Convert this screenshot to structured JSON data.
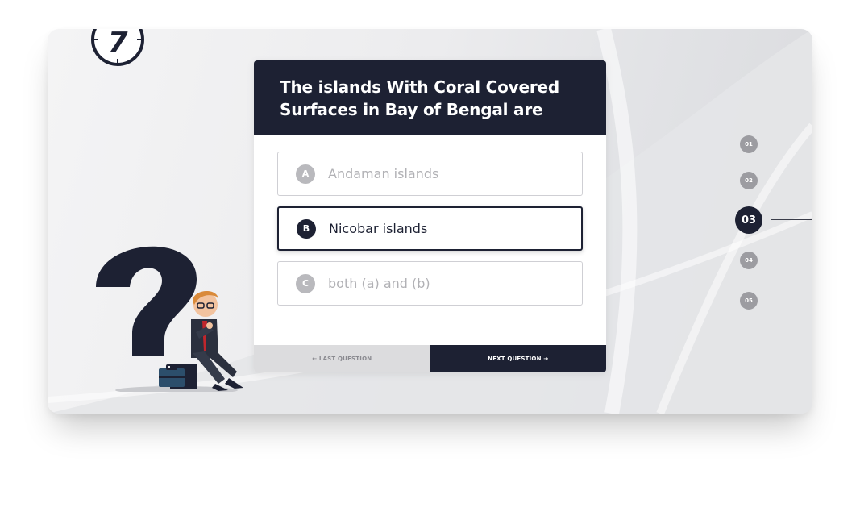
{
  "timer": {
    "value": "7"
  },
  "question": {
    "line1": "The islands With Coral Covered",
    "line2": "Surfaces in Bay of Bengal are"
  },
  "options": [
    {
      "letter": "A",
      "text": "Andaman islands",
      "selected": false
    },
    {
      "letter": "B",
      "text": "Nicobar islands",
      "selected": true
    },
    {
      "letter": "C",
      "text": "both (a) and (b)",
      "selected": false
    }
  ],
  "nav": {
    "prev_label": "← LAST QUESTION",
    "next_label": "NEXT QUESTION →"
  },
  "steps": [
    "01",
    "02",
    "03",
    "04",
    "05"
  ],
  "active_step": "03",
  "colors": {
    "primary": "#1d2133",
    "muted": "#9c9ca1",
    "border": "#cfcfd4"
  },
  "icons": {
    "timer": "stopwatch-icon",
    "illustration": "question-mark-businessman-illustration"
  }
}
